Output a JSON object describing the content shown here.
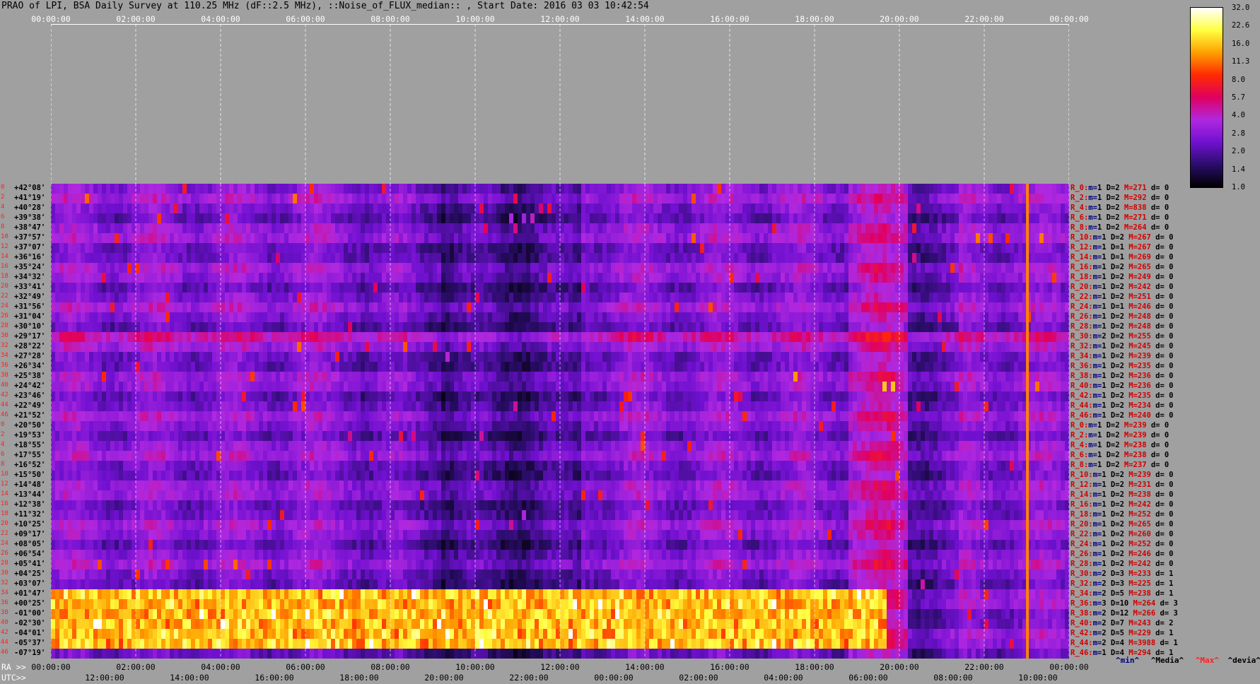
{
  "title": "PRAO of LPI, BSA Daily Survey at 110.25 MHz (dF::2.5 MHz), ::Noise_of_FLUX_median:: , Start Date: 2016 03 03 10:42:54",
  "ra_prefix": "RA >>",
  "utc_prefix": "UTC>>",
  "colors": {
    "background": "#a0a0a0",
    "grid": "#ffffff"
  },
  "chart_data": {
    "type": "heatmap",
    "colormap": [
      "#000000",
      "#2a0d6a",
      "#7010d0",
      "#b028e0",
      "#e00060",
      "#ff2a00",
      "#ffa000",
      "#ffff40",
      "#ffffff"
    ],
    "colorbar_ticks": [
      "32.0",
      "22.6",
      "16.0",
      "11.3",
      "8.0",
      "5.7",
      "4.0",
      "2.8",
      "2.0",
      "1.4",
      "1.0"
    ],
    "top_ra_ticks": [
      "00:00:00",
      "02:00:00",
      "04:00:00",
      "06:00:00",
      "08:00:00",
      "10:00:00",
      "12:00:00",
      "14:00:00",
      "16:00:00",
      "18:00:00",
      "20:00:00",
      "22:00:00",
      "00:00:00"
    ],
    "bottom_ra_ticks": [
      "00:00:00",
      "02:00:00",
      "04:00:00",
      "06:00:00",
      "08:00:00",
      "10:00:00",
      "12:00:00",
      "14:00:00",
      "16:00:00",
      "18:00:00",
      "20:00:00",
      "22:00:00",
      "00:00:00"
    ],
    "utc_ticks": [
      "12:00:00",
      "14:00:00",
      "16:00:00",
      "18:00:00",
      "20:00:00",
      "22:00:00",
      "00:00:00",
      "02:00:00",
      "04:00:00",
      "06:00:00",
      "08:00:00",
      "10:00:00"
    ],
    "declinations": [
      "+42°08'",
      "+41°19'",
      "+40°28'",
      "+39°38'",
      "+38°47'",
      "+37°57'",
      "+37°07'",
      "+36°16'",
      "+35°24'",
      "+34°32'",
      "+33°41'",
      "+32°49'",
      "+31°56'",
      "+31°04'",
      "+30°10'",
      "+29°17'",
      "+28°22'",
      "+27°28'",
      "+26°34'",
      "+25°38'",
      "+24°42'",
      "+23°46'",
      "+22°49'",
      "+21°52'",
      "+20°50'",
      "+19°53'",
      "+18°55'",
      "+17°55'",
      "+16°52'",
      "+15°50'",
      "+14°48'",
      "+13°44'",
      "+12°38'",
      "+11°32'",
      "+10°25'",
      "+09°17'",
      "+08°05'",
      "+06°54'",
      "+05°41'",
      "+04°25'",
      "+03°07'",
      "+01°47'",
      "+00°25'",
      "-01°00'",
      "-02°30'",
      "-04°01'",
      "-05°37'",
      "-07°19'"
    ],
    "dec_index": [
      "0",
      "2",
      "4",
      "6",
      "8",
      "10",
      "12",
      "14",
      "16",
      "18",
      "20",
      "22",
      "24",
      "26",
      "28",
      "30",
      "32",
      "34",
      "36",
      "38",
      "40",
      "42",
      "44",
      "46",
      "0",
      "2",
      "4",
      "6",
      "8",
      "10",
      "12",
      "14",
      "16",
      "18",
      "20",
      "22",
      "24",
      "26",
      "28",
      "30",
      "32",
      "34",
      "36",
      "38",
      "40",
      "42",
      "44",
      "46"
    ],
    "stats": [
      {
        "r": "R_0:",
        "m": "1",
        "D": "2",
        "M": "271",
        "d": "0"
      },
      {
        "r": "R_2:",
        "m": "1",
        "D": "2",
        "M": "292",
        "d": "0"
      },
      {
        "r": "R_4:",
        "m": "1",
        "D": "2",
        "M": "838",
        "d": "0"
      },
      {
        "r": "R_6:",
        "m": "1",
        "D": "2",
        "M": "271",
        "d": "0"
      },
      {
        "r": "R_8:",
        "m": "1",
        "D": "2",
        "M": "264",
        "d": "0"
      },
      {
        "r": "R_10:",
        "m": "1",
        "D": "2",
        "M": "267",
        "d": "0"
      },
      {
        "r": "R_12:",
        "m": "1",
        "D": "1",
        "M": "267",
        "d": "0"
      },
      {
        "r": "R_14:",
        "m": "1",
        "D": "1",
        "M": "269",
        "d": "0"
      },
      {
        "r": "R_16:",
        "m": "1",
        "D": "2",
        "M": "265",
        "d": "0"
      },
      {
        "r": "R_18:",
        "m": "1",
        "D": "2",
        "M": "249",
        "d": "0"
      },
      {
        "r": "R_20:",
        "m": "1",
        "D": "2",
        "M": "242",
        "d": "0"
      },
      {
        "r": "R_22:",
        "m": "1",
        "D": "2",
        "M": "251",
        "d": "0"
      },
      {
        "r": "R_24:",
        "m": "1",
        "D": "1",
        "M": "246",
        "d": "0"
      },
      {
        "r": "R_26:",
        "m": "1",
        "D": "2",
        "M": "248",
        "d": "0"
      },
      {
        "r": "R_28:",
        "m": "1",
        "D": "2",
        "M": "248",
        "d": "0"
      },
      {
        "r": "R_30:",
        "m": "2",
        "D": "2",
        "M": "255",
        "d": "0"
      },
      {
        "r": "R_32:",
        "m": "1",
        "D": "2",
        "M": "245",
        "d": "0"
      },
      {
        "r": "R_34:",
        "m": "1",
        "D": "2",
        "M": "239",
        "d": "0"
      },
      {
        "r": "R_36:",
        "m": "1",
        "D": "2",
        "M": "235",
        "d": "0"
      },
      {
        "r": "R_38:",
        "m": "1",
        "D": "2",
        "M": "236",
        "d": "0"
      },
      {
        "r": "R_40:",
        "m": "1",
        "D": "2",
        "M": "236",
        "d": "0"
      },
      {
        "r": "R_42:",
        "m": "1",
        "D": "2",
        "M": "235",
        "d": "0"
      },
      {
        "r": "R_44:",
        "m": "1",
        "D": "2",
        "M": "234",
        "d": "0"
      },
      {
        "r": "R_46:",
        "m": "1",
        "D": "2",
        "M": "240",
        "d": "0"
      },
      {
        "r": "R_0:",
        "m": "1",
        "D": "2",
        "M": "239",
        "d": "0"
      },
      {
        "r": "R_2:",
        "m": "1",
        "D": "2",
        "M": "239",
        "d": "0"
      },
      {
        "r": "R_4:",
        "m": "1",
        "D": "2",
        "M": "238",
        "d": "0"
      },
      {
        "r": "R_6:",
        "m": "1",
        "D": "2",
        "M": "238",
        "d": "0"
      },
      {
        "r": "R_8:",
        "m": "1",
        "D": "2",
        "M": "237",
        "d": "0"
      },
      {
        "r": "R_10:",
        "m": "1",
        "D": "2",
        "M": "239",
        "d": "0"
      },
      {
        "r": "R_12:",
        "m": "1",
        "D": "2",
        "M": "231",
        "d": "0"
      },
      {
        "r": "R_14:",
        "m": "1",
        "D": "2",
        "M": "238",
        "d": "0"
      },
      {
        "r": "R_16:",
        "m": "1",
        "D": "2",
        "M": "242",
        "d": "0"
      },
      {
        "r": "R_18:",
        "m": "1",
        "D": "2",
        "M": "252",
        "d": "0"
      },
      {
        "r": "R_20:",
        "m": "1",
        "D": "2",
        "M": "265",
        "d": "0"
      },
      {
        "r": "R_22:",
        "m": "1",
        "D": "2",
        "M": "260",
        "d": "0"
      },
      {
        "r": "R_24:",
        "m": "1",
        "D": "2",
        "M": "252",
        "d": "0"
      },
      {
        "r": "R_26:",
        "m": "1",
        "D": "2",
        "M": "246",
        "d": "0"
      },
      {
        "r": "R_28:",
        "m": "1",
        "D": "2",
        "M": "242",
        "d": "0"
      },
      {
        "r": "R_30:",
        "m": "2",
        "D": "3",
        "M": "233",
        "d": "1"
      },
      {
        "r": "R_32:",
        "m": "2",
        "D": "3",
        "M": "225",
        "d": "1"
      },
      {
        "r": "R_34:",
        "m": "2",
        "D": "5",
        "M": "238",
        "d": "1"
      },
      {
        "r": "R_36:",
        "m": "3",
        "D": "10",
        "M": "264",
        "d": "3"
      },
      {
        "r": "R_38:",
        "m": "2",
        "D": "12",
        "M": "266",
        "d": "3"
      },
      {
        "r": "R_40:",
        "m": "2",
        "D": "7",
        "M": "243",
        "d": "2"
      },
      {
        "r": "R_42:",
        "m": "2",
        "D": "5",
        "M": "229",
        "d": "1"
      },
      {
        "r": "R_44:",
        "m": "2",
        "D": "4",
        "M": "3988",
        "d": "1"
      },
      {
        "r": "R_46:",
        "m": "1",
        "D": "4",
        "M": "294",
        "d": "1"
      }
    ],
    "stat_legend": {
      "min": "^min^",
      "median": "^Media^",
      "max": "^Max^",
      "deviation": "^devia^"
    }
  }
}
